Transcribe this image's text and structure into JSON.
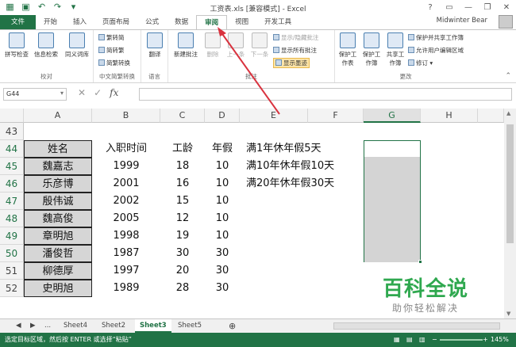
{
  "window": {
    "title": "工资表.xls [兼容模式] - Excel",
    "user": "Midwinter Bear"
  },
  "tabs": [
    "文件",
    "开始",
    "插入",
    "页面布局",
    "公式",
    "数据",
    "审阅",
    "视图",
    "开发工具"
  ],
  "ribbon": {
    "g1": {
      "label": "校对",
      "b1": "拼写检查",
      "b2": "信息检索",
      "b3": "同义词库"
    },
    "g2": {
      "label": "中文简繁转换",
      "b1": "繁转简",
      "b2": "简转繁",
      "b3": "简繁转换"
    },
    "g3": {
      "label": "语言",
      "b1": "翻译"
    },
    "g4": {
      "label": "批注",
      "b1": "新建批注",
      "b2": "删除",
      "b3": "上一条",
      "b4": "下一条",
      "s1": "显示/隐藏批注",
      "s2": "显示所有批注",
      "s3": "显示墨迹"
    },
    "g5": {
      "label": "更改",
      "b1": "保护工作表",
      "b2": "保护工作簿",
      "b3": "共享工作簿",
      "s1": "保护并共享工作簿",
      "s2": "允许用户编辑区域",
      "s3": "修订"
    }
  },
  "namebox": "G44",
  "columns": [
    "A",
    "B",
    "C",
    "D",
    "E",
    "F",
    "G",
    "H"
  ],
  "rows": [
    "43",
    "44",
    "45",
    "46",
    "47",
    "48",
    "49",
    "50",
    "51",
    "52"
  ],
  "header": {
    "name": "姓名",
    "date": "入职时间",
    "age": "工龄",
    "leave": "年假"
  },
  "employees": [
    {
      "name": "魏嘉志",
      "date": "1999",
      "age": "18",
      "leave": "10"
    },
    {
      "name": "乐彦博",
      "date": "2001",
      "age": "16",
      "leave": "10"
    },
    {
      "name": "殷伟诚",
      "date": "2002",
      "age": "15",
      "leave": "10"
    },
    {
      "name": "魏高俊",
      "date": "2005",
      "age": "12",
      "leave": "10"
    },
    {
      "name": "章明旭",
      "date": "1998",
      "age": "19",
      "leave": "10"
    },
    {
      "name": "潘俊哲",
      "date": "1987",
      "age": "30",
      "leave": "30"
    },
    {
      "name": "柳德厚",
      "date": "1997",
      "age": "20",
      "leave": "30"
    },
    {
      "name": "史明旭",
      "date": "1989",
      "age": "28",
      "leave": "30"
    }
  ],
  "rules": [
    "满1年休年假5天",
    "满10年休年假10天",
    "满20年休年假30天"
  ],
  "sheets": [
    "...",
    "Sheet4",
    "Sheet2",
    "Sheet3",
    "Sheet5"
  ],
  "status": {
    "message": "选定目标区域，然后按 ENTER 或选择“粘贴”",
    "zoom": "145%"
  },
  "watermark": {
    "title": "百科全说",
    "subtitle": "助你轻松解决"
  },
  "colors": {
    "accent": "#217346",
    "arrow": "#d9333f",
    "watermark": "#2fa84f"
  },
  "icons": [
    "save-icon",
    "undo-icon",
    "redo-icon",
    "minimize-icon",
    "restore-icon",
    "close-icon",
    "help-icon",
    "fx-icon"
  ]
}
